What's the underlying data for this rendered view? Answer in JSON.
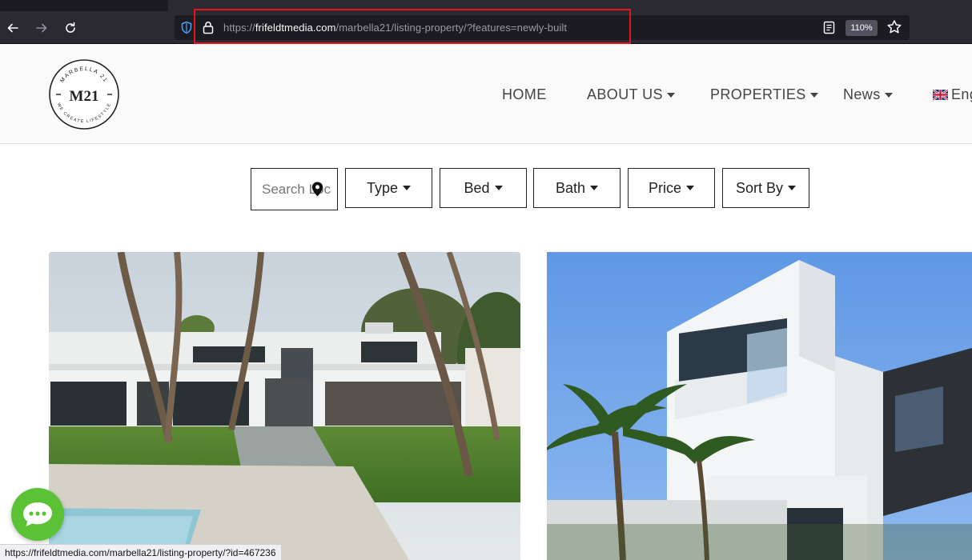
{
  "browser": {
    "url_prefix": "https://",
    "url_host": "frifeldtmedia.com",
    "url_path": "/marbella21/listing-property/?features=newly-built",
    "zoom": "110%",
    "status_link": "https://frifeldtmedia.com/marbella21/listing-property/?id=467236",
    "accent_highlight": "#e3151a"
  },
  "logo": {
    "top_text": "MARBELLA 21",
    "mark": "M21",
    "bottom_text": "WE CREATE LIFESTYLE"
  },
  "nav": {
    "home": "HOME",
    "about": "ABOUT US",
    "properties": "PROPERTIES",
    "news": "News",
    "language": "Eng"
  },
  "filters": {
    "search_placeholder": "Search Location",
    "type": "Type",
    "bed": "Bed",
    "bath": "Bath",
    "price": "Price",
    "sort": "Sort By"
  },
  "icons": {
    "back": "arrow-left-icon",
    "forward": "arrow-right-icon",
    "reload": "reload-icon",
    "shield": "tracking-shield-icon",
    "lock": "lock-icon",
    "reader": "reader-view-icon",
    "bookmark": "star-icon",
    "location": "map-pin-icon",
    "chat": "chat-bubble-icon"
  },
  "colors": {
    "chat_button": "#5bc236",
    "nav_text": "#444444"
  }
}
